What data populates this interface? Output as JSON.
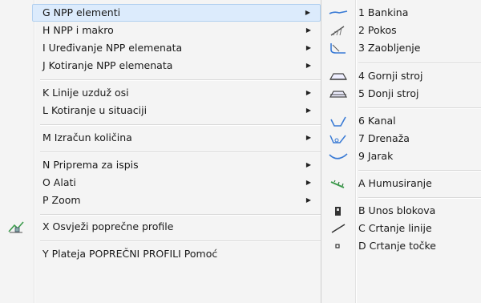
{
  "main_menu": {
    "items": [
      {
        "label": "G NPP elementi",
        "submenu": true
      },
      {
        "label": "H NPP i makro",
        "submenu": true
      },
      {
        "label": "I Uređivanje NPP elemenata",
        "submenu": true
      },
      {
        "label": "J Kotiranje NPP elemenata",
        "submenu": true
      },
      {
        "label": "K Linije uzduž osi",
        "submenu": true
      },
      {
        "label": "L Kotiranje u situaciji",
        "submenu": true
      },
      {
        "label": "M Izračun količina",
        "submenu": true
      },
      {
        "label": "N Priprema za ispis",
        "submenu": true
      },
      {
        "label": "O Alati",
        "submenu": true
      },
      {
        "label": "P Zoom",
        "submenu": true
      },
      {
        "label": "X Osvježi poprečne profile",
        "submenu": false
      },
      {
        "label": "Y Plateja POPREČNI PROFILI Pomoć",
        "submenu": false
      }
    ],
    "submenu_arrow": "▶",
    "icons": {
      "refresh": "refresh-profiles-icon"
    }
  },
  "submenu": {
    "items": [
      {
        "label": "1 Bankina",
        "icon": "bankina-icon"
      },
      {
        "label": "2 Pokos",
        "icon": "pokos-icon"
      },
      {
        "label": "3 Zaobljenje",
        "icon": "zaobljenje-icon"
      },
      {
        "label": "4 Gornji stroj",
        "icon": "gornji-stroj-icon"
      },
      {
        "label": "5 Donji stroj",
        "icon": "donji-stroj-icon"
      },
      {
        "label": "6 Kanal",
        "icon": "kanal-icon"
      },
      {
        "label": "7 Drenaža",
        "icon": "drenaza-icon"
      },
      {
        "label": "9 Jarak",
        "icon": "jarak-icon"
      },
      {
        "label": "A Humusiranje",
        "icon": "humusiranje-icon"
      },
      {
        "label": "B Unos blokova",
        "icon": "unos-blokova-icon"
      },
      {
        "label": "C Crtanje linije",
        "icon": "crtanje-linije-icon"
      },
      {
        "label": "D Crtanje točke",
        "icon": "crtanje-tocke-icon"
      }
    ]
  },
  "colors": {
    "highlight_bg": "#dcebfc",
    "highlight_border": "#b2d0f0",
    "menu_bg": "#f4f4f4",
    "icon_blue": "#3a7bd5",
    "icon_green": "#3a9a4a"
  }
}
